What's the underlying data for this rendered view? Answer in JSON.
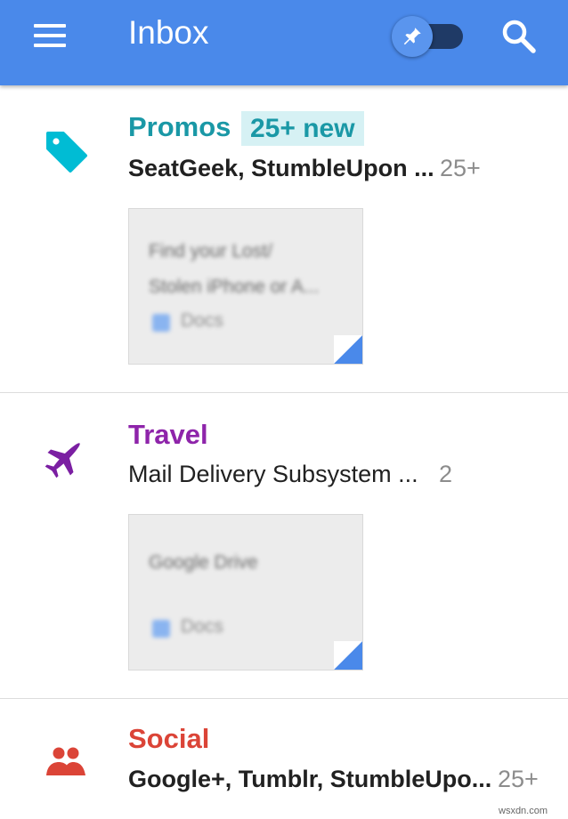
{
  "app_bar": {
    "title": "Inbox",
    "menu_icon": "hamburger-menu-icon",
    "pin_toggle_icon": "pushpin-icon",
    "search_icon": "search-icon",
    "color": "#4a89ea"
  },
  "bundles": [
    {
      "category": "Promos",
      "category_color": "#1a98a6",
      "icon": "tag-icon",
      "icon_color": "#00bcd4",
      "new_badge": "25+ new",
      "senders": "SeatGeek, StumbleUpon ...",
      "count": "25+",
      "attachment": {
        "lines": [
          "Find your Lost/",
          "Stolen iPhone or A..."
        ],
        "type_label": "Docs"
      }
    },
    {
      "category": "Travel",
      "category_color": "#8e24aa",
      "icon": "airplane-icon",
      "icon_color": "#7b1fa2",
      "senders": "Mail Delivery Subsystem ...",
      "count": "2",
      "attachment": {
        "lines": [
          "Google Drive"
        ],
        "type_label": "Docs"
      }
    },
    {
      "category": "Social",
      "category_color": "#db4437",
      "icon": "people-icon",
      "icon_color": "#db4437",
      "senders": "Google+, Tumblr, StumbleUpo...",
      "count": "25+"
    }
  ],
  "watermark": "wsxdn.com"
}
